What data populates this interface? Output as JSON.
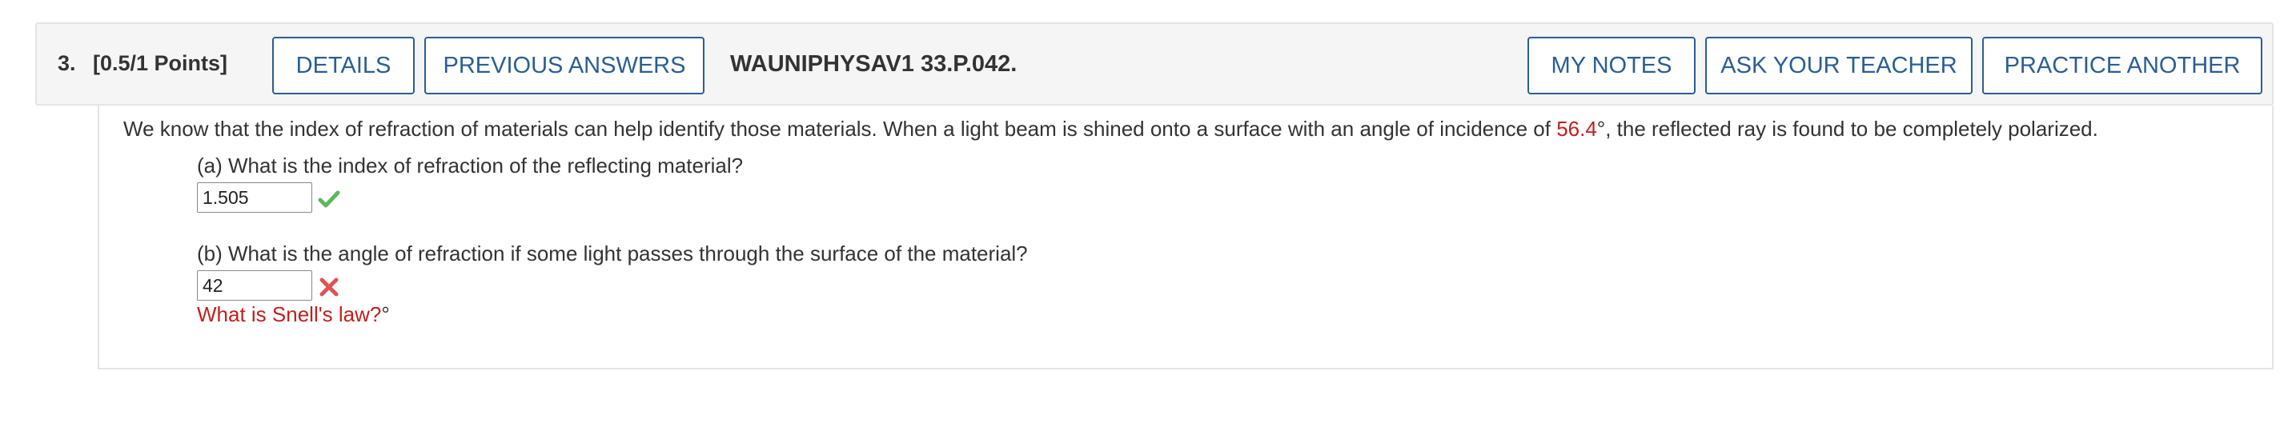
{
  "header": {
    "number": "3.",
    "points": "[0.5/1 Points]",
    "details_label": "DETAILS",
    "previous_answers_label": "PREVIOUS ANSWERS",
    "question_id": "WAUNIPHYSAV1 33.P.042.",
    "my_notes_label": "MY NOTES",
    "ask_teacher_label": "ASK YOUR TEACHER",
    "practice_another_label": "PRACTICE ANOTHER"
  },
  "question": {
    "text_before": "We know that the index of refraction of materials can help identify those materials. When a light beam is shined onto a surface with an angle of incidence of ",
    "angle_value": "56.4",
    "text_after": "°, the reflected ray is found to be completely polarized."
  },
  "parts": [
    {
      "prompt": "(a) What is the index of refraction of the reflecting material?",
      "answer": "1.505",
      "status": "correct",
      "status_icon": "check-icon",
      "status_color": "#5cb85c"
    },
    {
      "prompt": "(b) What is the angle of refraction if some light passes through the surface of the material?",
      "answer": "42",
      "status": "incorrect",
      "status_icon": "cross-icon",
      "status_color": "#e05252",
      "hint": "What is Snell's law?",
      "unit": "°"
    }
  ],
  "colors": {
    "accent": "#2a5e93",
    "highlight_red": "#c41e1e"
  }
}
